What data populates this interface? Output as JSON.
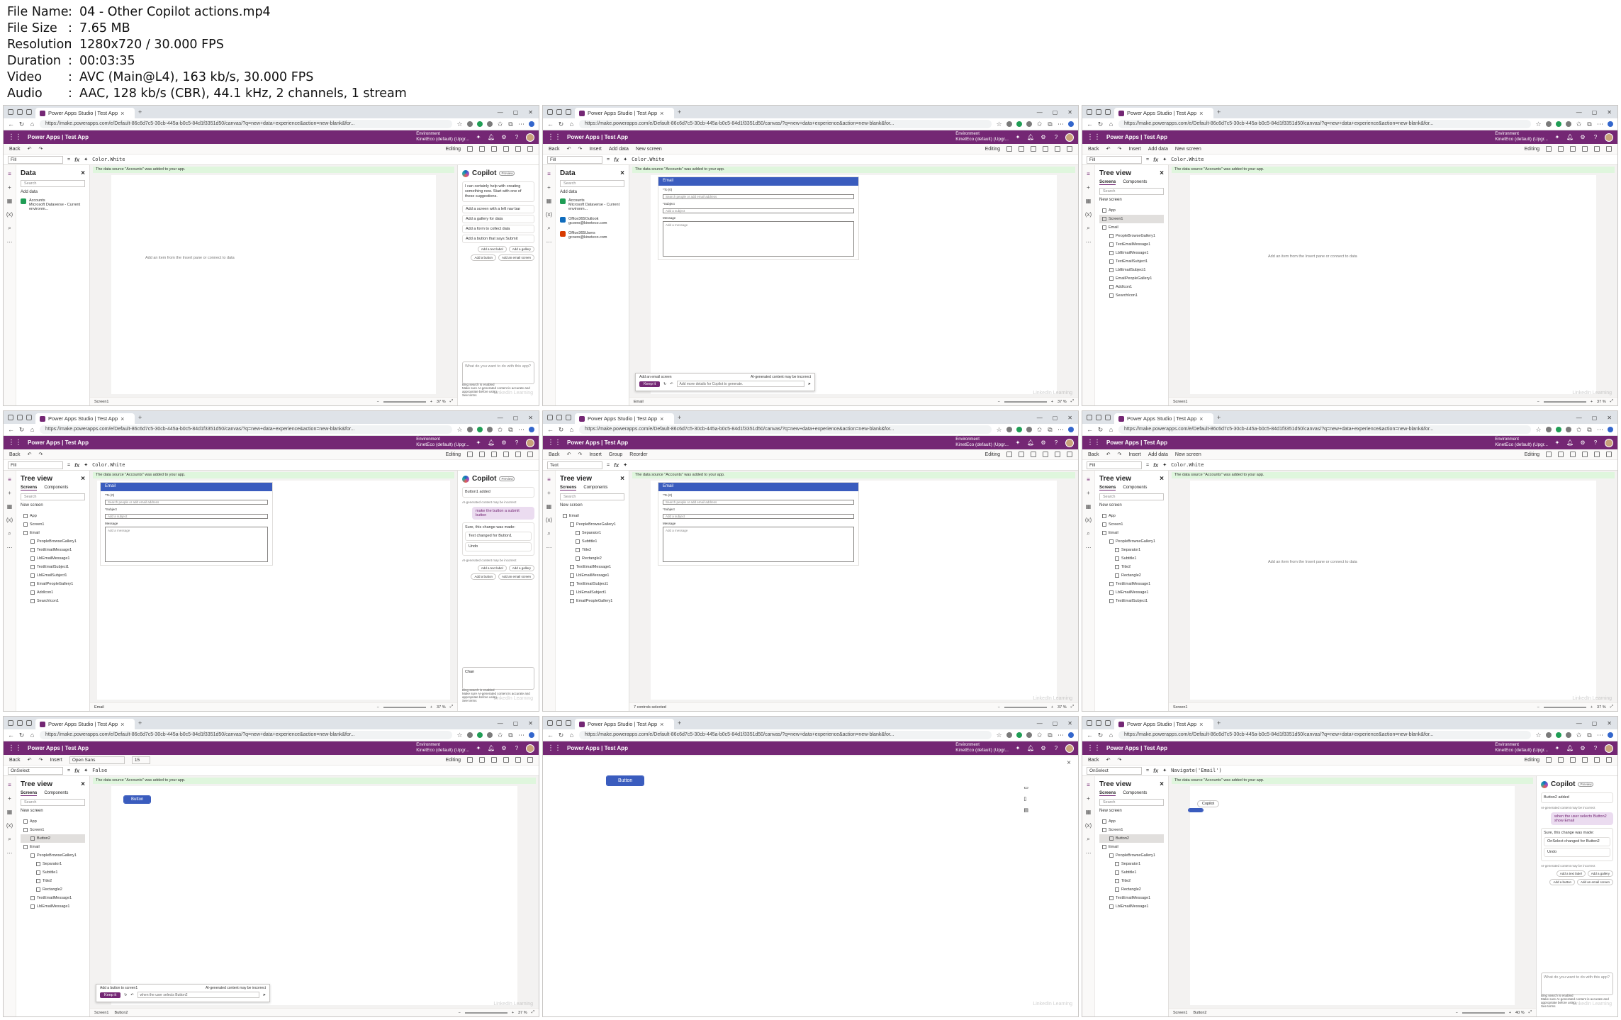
{
  "info": {
    "rows": [
      {
        "key": "File Name",
        "value": "04 - Other Copilot actions.mp4"
      },
      {
        "key": "File Size",
        "value": "7.65 MB"
      },
      {
        "key": "Resolution",
        "value": "1280x720 / 30.000 FPS"
      },
      {
        "key": "Duration",
        "value": "00:03:35"
      },
      {
        "key": "Video",
        "value": "AVC (Main@L4), 163 kb/s, 30.000 FPS"
      },
      {
        "key": "Audio",
        "value": "AAC, 128 kb/s (CBR), 44.1 kHz, 2 channels, 1 stream"
      }
    ]
  },
  "common": {
    "tab_title": "Power Apps Studio | Test App",
    "url": "https://make.powerapps.com/e/Default-86c6d7c5-30cb-445a-b0c5-84d1f3351d50/canvas/?q=new+data+experience&action=new-blank&for...",
    "app_title": "Power Apps  |  Test App",
    "env_label": "Environment",
    "env_name": "KinetEco (default) (Upgr...",
    "back": "Back",
    "insert": "Insert",
    "add_data": "Add data",
    "new_screen": "New screen",
    "editing": "Editing",
    "group": "Group",
    "reorder": "Reorder",
    "notice": "The data source \"Accounts\" was added to your app.",
    "empty_msg": "Add an item from the Insert pane or connect to data",
    "search": "Search",
    "screens_tab": "Screens",
    "components_tab": "Components",
    "new_screen_link": "New screen",
    "tree_view": "Tree view",
    "data_title": "Data",
    "add_data_link": "Add data",
    "copilot": "Copilot",
    "preview": "Preview",
    "copilot_placeholder": "What do you want to do with this app?",
    "bing": "Bing search is enabled",
    "disclaimer": "Make sure AI-generated content is accurate and appropriate before using.",
    "see_terms": "See terms",
    "keep_it": "Keep it",
    "ai_warning": "AI-generated content may be incorrect",
    "zoom": "37 %",
    "email_title": "Email",
    "email_to": "*To (0)",
    "email_to_ph": "Search people or add email address",
    "email_subject": "*Subject",
    "email_subject_ph": "Add a subject",
    "email_message": "Message",
    "email_message_ph": "Add a message"
  },
  "frames": [
    {
      "prop": "Fill",
      "formula": "Color.White",
      "panel": "data",
      "status": "Screen1",
      "copilot_msg": "I can certainly help with creating something new. Start with one of these suggestions.",
      "suggestions": [
        "Add a screen with a left nav bar",
        "Add a gallery for data",
        "Add a form to collect data",
        "Add a button that says Submit"
      ],
      "chips": [
        "Add a text label",
        "Add a gallery",
        "Add a button",
        "Add an email screen"
      ],
      "data_sources": [
        {
          "name": "Accounts",
          "sub": "Microsoft Dataverse - Current environm..."
        }
      ]
    },
    {
      "prop": "Fill",
      "formula": "Color.White",
      "panel": "data",
      "status": "Email",
      "gen_label": "Add an email screen",
      "gen_placeholder": "Add more details for Copilot to generate.",
      "data_sources": [
        {
          "name": "Accounts",
          "sub": "Microsoft Dataverse - Current environm..."
        },
        {
          "name": "Office365Outlook",
          "sub": "gcoers@kineteco.com"
        },
        {
          "name": "Office365Users",
          "sub": "gcoers@kineteco.com"
        }
      ]
    },
    {
      "prop": "Fill",
      "formula": "Color.White",
      "panel": "tree",
      "status": "Screen1",
      "tree": [
        "App",
        "Screen1",
        "Email",
        "PeopleBrowseGallery1",
        "TextEmailMessage1",
        "LblEmailMessage1",
        "TextEmailSubject1",
        "LblEmailSubject1",
        "EmailPeopleGallery1",
        "AddIcon1",
        "SearchIcon1"
      ]
    },
    {
      "prop": "Fill",
      "formula": "Color.White",
      "panel": "tree",
      "status": "Email",
      "tree": [
        "App",
        "Screen1",
        "Email",
        "PeopleBrowseGallery1",
        "TextEmailMessage1",
        "LblEmailMessage1",
        "TextEmailSubject1",
        "LblEmailSubject1",
        "EmailPeopleGallery1",
        "AddIcon1",
        "SearchIcon1"
      ],
      "copilot_added": "Button1 added",
      "user_msg": "make the button a submit button",
      "reply": "Sure, this change was made:",
      "change": "Text changed for Button1",
      "undo": "Undo",
      "chips": [
        "Add a text label",
        "Add a gallery",
        "Add a button",
        "Add an email screen"
      ],
      "typed": "Chan"
    },
    {
      "prop": "Text",
      "formula": "",
      "panel": "tree",
      "status": "7 controls selected",
      "tree": [
        "Email",
        "PeopleBrowseGallery1",
        "Separator1",
        "Subtitle1",
        "Title2",
        "Rectangle2",
        "TextEmailMessage1",
        "LblEmailMessage1",
        "TextEmailSubject1",
        "LblEmailSubject1",
        "EmailPeopleGallery1"
      ]
    },
    {
      "prop": "Fill",
      "formula": "Color.White",
      "panel": "tree",
      "status": "Screen1",
      "tree": [
        "App",
        "Screen1",
        "Email",
        "PeopleBrowseGallery1",
        "Separator1",
        "Subtitle1",
        "Title2",
        "Rectangle2",
        "TextEmailMessage1",
        "LblEmailMessage1",
        "TextEmailSubject1"
      ]
    },
    {
      "prop": "OnSelect",
      "formula": "False",
      "panel": "tree",
      "status": "Screen1",
      "status2": "Button2",
      "font": "Open Sans",
      "font_size": "15",
      "tree": [
        "App",
        "Screen1",
        "Button2",
        "Email",
        "PeopleBrowseGallery1",
        "Separator1",
        "Subtitle1",
        "Title2",
        "Rectangle2",
        "TextEmailMessage1",
        "LblEmailMessage1"
      ],
      "button_label": "Button",
      "gen_label": "Add a button to screen1",
      "gen_value": "when the user selects Button2"
    },
    {
      "panel": "preview",
      "button_label": "Button",
      "close": "×"
    },
    {
      "prop": "OnSelect",
      "formula": "Navigate('Email')",
      "panel": "tree",
      "status": "Screen1",
      "status2": "Button2",
      "tree": [
        "App",
        "Screen1",
        "Button2",
        "Email",
        "PeopleBrowseGallery1",
        "Separator1",
        "Subtitle1",
        "Title2",
        "Rectangle2",
        "TextEmailMessage1",
        "LblEmailMessage1"
      ],
      "copilot_added": "Button2 added",
      "user_msg": "when the user selects Button2 show Email",
      "reply": "Sure, this change was made:",
      "change": "OnSelect changed for Button2",
      "undo": "Undo",
      "chips": [
        "Add a text label",
        "Add a gallery",
        "Add a button",
        "Add an email screen"
      ],
      "zoom": "40 %",
      "tooltip": "Copilot"
    }
  ],
  "colors": {
    "brand": "#742774",
    "accent": "#3a5cbe",
    "notice_bg": "#dff6dd"
  },
  "watermark": "LinkedIn Learning"
}
